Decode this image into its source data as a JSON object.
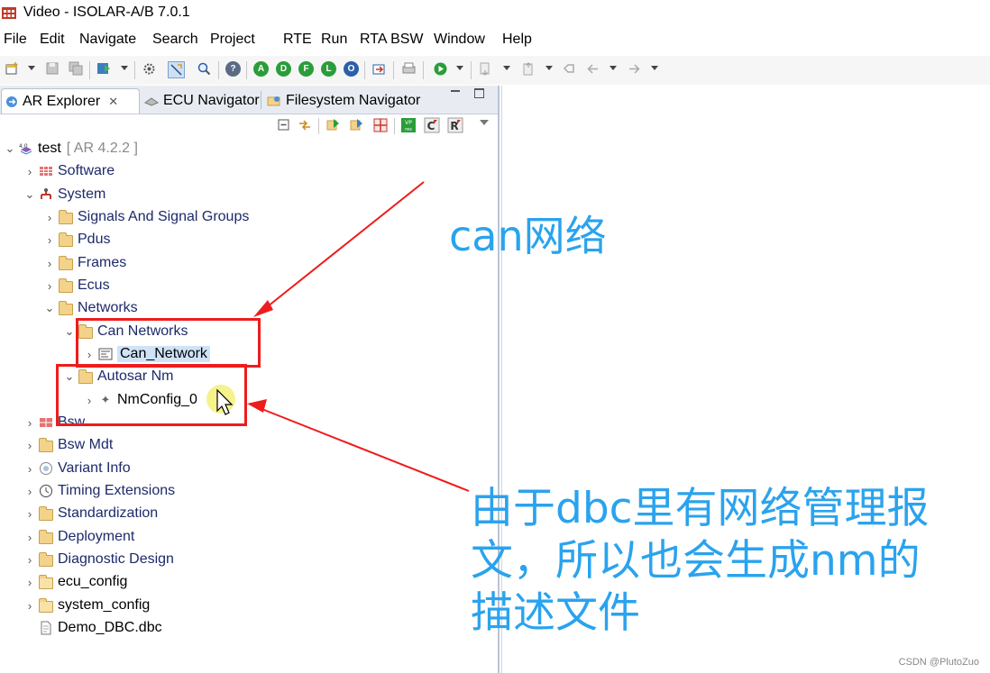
{
  "window": {
    "title": "Video - ISOLAR-A/B 7.0.1"
  },
  "menu": [
    "File",
    "Edit",
    "Navigate",
    "Search",
    "Project",
    "RTE",
    "Run",
    "RTA BSW",
    "Window",
    "Help"
  ],
  "toolbar_circles": [
    {
      "letter": "?",
      "color": "#5a6b85"
    },
    {
      "letter": "A",
      "color": "#2a9d3a"
    },
    {
      "letter": "D",
      "color": "#2a9d3a"
    },
    {
      "letter": "F",
      "color": "#2a9d3a"
    },
    {
      "letter": "L",
      "color": "#2a9d3a"
    },
    {
      "letter": "O",
      "color": "#2c5fa8"
    }
  ],
  "tabs": {
    "ar_explorer": "AR Explorer",
    "ecu_navigator": "ECU Navigator",
    "filesystem_navigator": "Filesystem Navigator"
  },
  "tree": {
    "root": "test",
    "root_version": "[ AR 4.2.2 ]",
    "software": "Software",
    "system": "System",
    "signals": "Signals And Signal Groups",
    "pdus": "Pdus",
    "frames": "Frames",
    "ecus": "Ecus",
    "networks": "Networks",
    "can_networks": "Can Networks",
    "can_network": "Can_Network",
    "autosar_nm": "Autosar Nm",
    "nmconfig": "NmConfig_0",
    "bsw": "Bsw",
    "bsw_mdt": "Bsw Mdt",
    "variant_info": "Variant Info",
    "timing_extensions": "Timing Extensions",
    "standardization": "Standardization",
    "deployment": "Deployment",
    "diagnostic_design": "Diagnostic Design",
    "ecu_config": "ecu_config",
    "system_config": "system_config",
    "demo_dbc": "Demo_DBC.dbc"
  },
  "annotations": {
    "can_label": "can网络",
    "nm_line1": "由于dbc里有网络管理报",
    "nm_line2": "文，所以也会生成nm的",
    "nm_line3": "描述文件",
    "color": "#2aa3ee",
    "box_color": "#ee1c1c"
  },
  "watermark": "CSDN @PlutoZuo"
}
